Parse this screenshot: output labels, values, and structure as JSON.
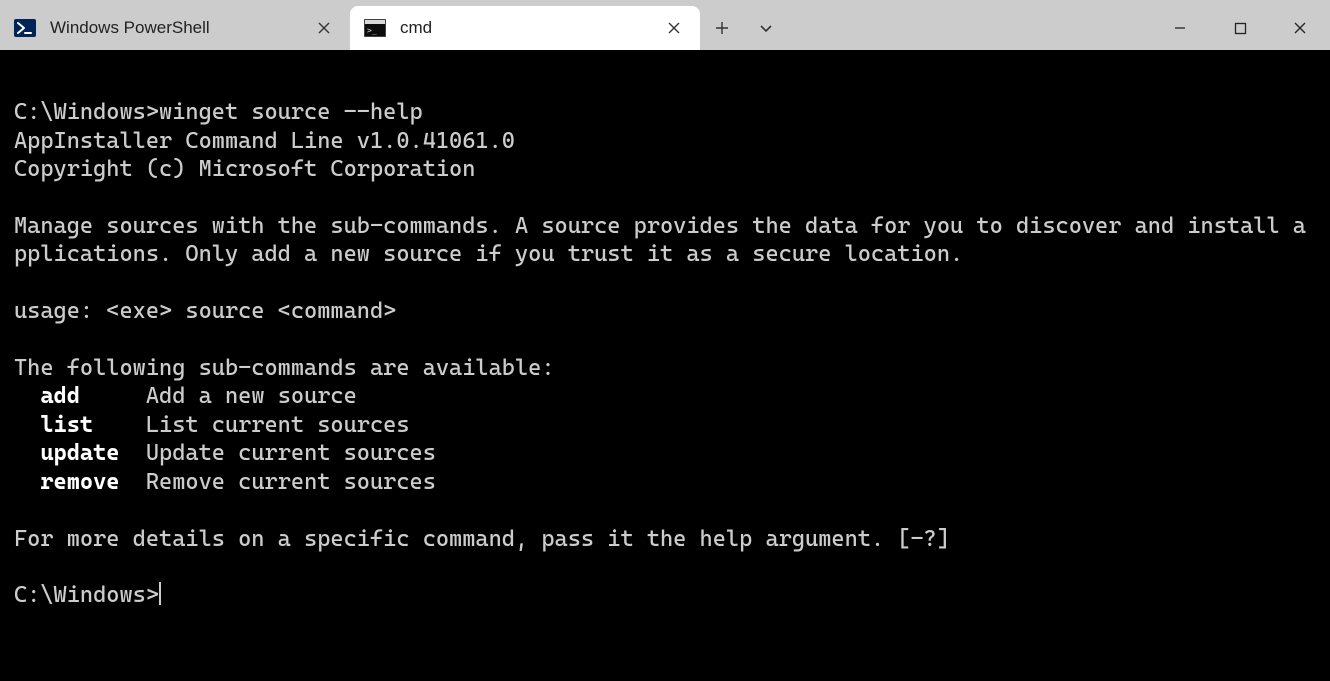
{
  "tabs": [
    {
      "label": "Windows PowerShell",
      "icon": "powershell-icon",
      "active": false
    },
    {
      "label": "cmd",
      "icon": "cmd-icon",
      "active": true
    }
  ],
  "terminal": {
    "prompt1": "C:\\Windows>",
    "command": "winget source --help",
    "version_line": "AppInstaller Command Line v1.0.41061.0",
    "copyright": "Copyright (c) Microsoft Corporation",
    "description": "Manage sources with the sub-commands. A source provides the data for you to discover and install applications. Only add a new source if you trust it as a secure location.",
    "usage": "usage: <exe> source <command>",
    "subcmd_header": "The following sub-commands are available:",
    "subcommands": [
      {
        "name": "add",
        "desc": "Add a new source"
      },
      {
        "name": "list",
        "desc": "List current sources"
      },
      {
        "name": "update",
        "desc": "Update current sources"
      },
      {
        "name": "remove",
        "desc": "Remove current sources"
      }
    ],
    "more_details": "For more details on a specific command, pass it the help argument. [-?]",
    "prompt2": "C:\\Windows>"
  }
}
